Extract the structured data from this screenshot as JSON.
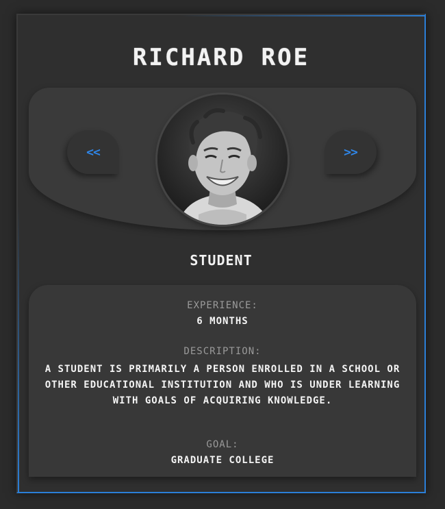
{
  "profile": {
    "name": "RICHARD ROE",
    "role": "STUDENT",
    "avatar_alt": "profile-photo"
  },
  "navigation": {
    "prev_label": "<<",
    "next_label": ">>"
  },
  "details": {
    "experience_label": "EXPERIENCE:",
    "experience_value": "6 MONTHS",
    "description_label": "DESCRIPTION:",
    "description_value": "A STUDENT IS PRIMARILY A PERSON ENROLLED IN A SCHOOL OR OTHER EDUCATIONAL INSTITUTION AND WHO IS UNDER LEARNING WITH GOALS OF ACQUIRING KNOWLEDGE.",
    "goal_label": "GOAL:",
    "goal_value": "GRADUATE COLLEGE"
  },
  "colors": {
    "background": "#2b2b2b",
    "card": "#2f2f2f",
    "panel": "#3a3a3a",
    "accent": "#2b7fd8",
    "text": "#f2f2f2",
    "muted": "#9a9a9a"
  }
}
